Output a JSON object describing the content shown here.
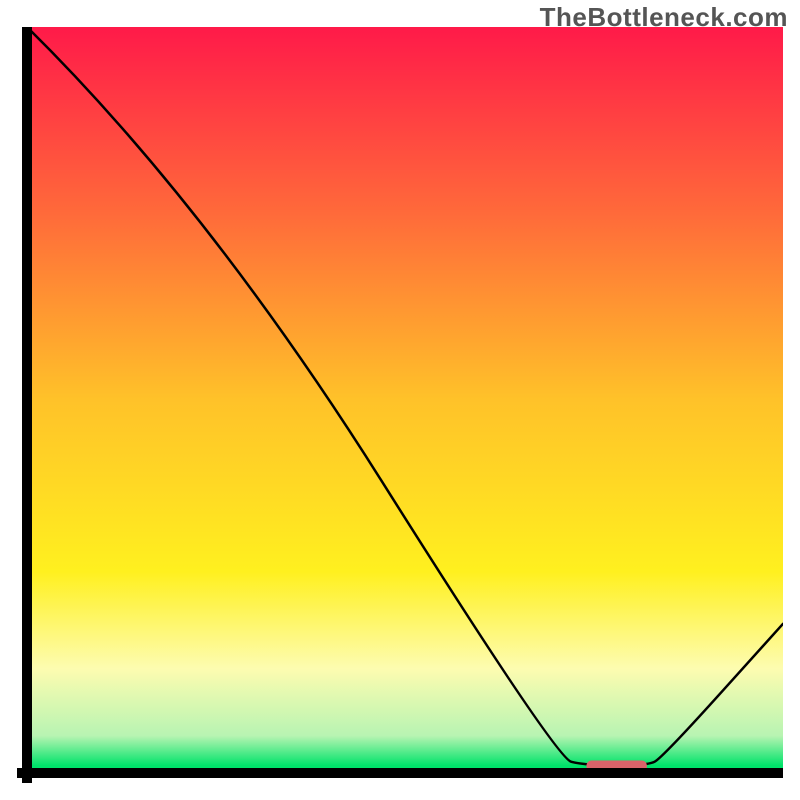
{
  "watermark": "TheBottleneck.com",
  "chart_data": {
    "type": "line",
    "title": "",
    "xlabel": "",
    "ylabel": "",
    "xlim": [
      0,
      100
    ],
    "ylim": [
      0,
      100
    ],
    "series": [
      {
        "name": "curve",
        "x": [
          0,
          24,
          70,
          74,
          82,
          84,
          100
        ],
        "y": [
          100,
          76,
          2,
          1,
          1,
          2,
          20
        ]
      }
    ],
    "marker_segment": {
      "x_start": 74,
      "x_end": 82,
      "y": 1
    },
    "background_gradient": {
      "stops": [
        {
          "pos": 0.0,
          "color": "#ff1a49"
        },
        {
          "pos": 0.25,
          "color": "#ff6a3a"
        },
        {
          "pos": 0.5,
          "color": "#ffc229"
        },
        {
          "pos": 0.73,
          "color": "#fff01f"
        },
        {
          "pos": 0.86,
          "color": "#fdfcb0"
        },
        {
          "pos": 0.95,
          "color": "#b8f4b2"
        },
        {
          "pos": 0.99,
          "color": "#00e36a"
        },
        {
          "pos": 1.0,
          "color": "#00e36a"
        }
      ]
    }
  }
}
